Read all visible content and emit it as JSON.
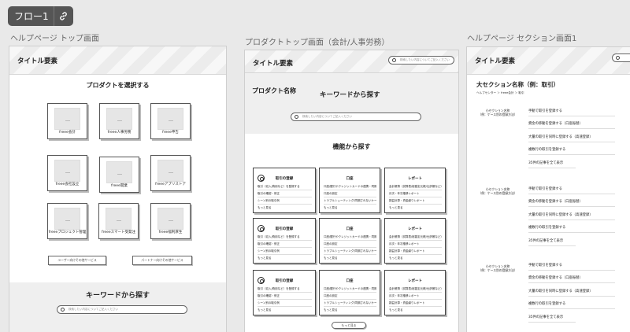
{
  "flow": {
    "label": "フロー1"
  },
  "frames": {
    "left_title": "ヘルプページ トップ画面",
    "mid_title": "プロダクトトップ画面（会計/人事労務）",
    "right_title": "ヘルプページ セクション画面1"
  },
  "header_title": "タイトル要素",
  "search_placeholder": "検索したい内容についてご記入ください",
  "left": {
    "heading": "プロダクトを選択する",
    "products": [
      "freee会計",
      "freee人事労務",
      "freee申告",
      "freee会社設立",
      "freee開業",
      "freeeアプリストア",
      "freeeプロジェクト管理",
      "freeeスマート受発注",
      "freee福利厚生"
    ],
    "user_buttons": [
      "ユーザー向けその他サービス",
      "パートナー向けその他サービス"
    ],
    "keyword_heading": "キーワードから探す"
  },
  "mid": {
    "product_name": "プロダクト名称",
    "keyword_heading": "キーワードから探す",
    "function_heading": "機能から探す",
    "cards": [
      {
        "title": "取引の登録",
        "rows": [
          "取引（収入/費用など）を登録する",
          "取引の確認・修正",
          "シーン別の取引例",
          "もっと見る"
        ]
      },
      {
        "title": "口座",
        "rows": [
          "口座/銀行やクレジットカードの連携・同期",
          "口座の設定",
          "トラブルシューティング/同期されないケース",
          "もっと見る"
        ]
      },
      {
        "title": "レポート",
        "rows": [
          "会計帳簿（試算表/総勘定元帳/仕訳帳など）",
          "月次・年次推移レポート",
          "損益計算・資金繰りレポート",
          "もっと見る"
        ]
      }
    ],
    "more_button": "もっと見る"
  },
  "right": {
    "section_title": "大セクション名称（例：取引）",
    "breadcrumb": "ヘルプセンター ＞ freee会計 ＞ 取引",
    "sub_label": "小セクション名称\n（例：ケース別の登録方法）",
    "items": [
      "手動で取引を登録する",
      "資金の移動を登録する（口座振替）",
      "大量の取引を同時に登録する（高速登録）",
      "複数行の取引を登録する",
      "35件の記事を全て表示"
    ]
  }
}
